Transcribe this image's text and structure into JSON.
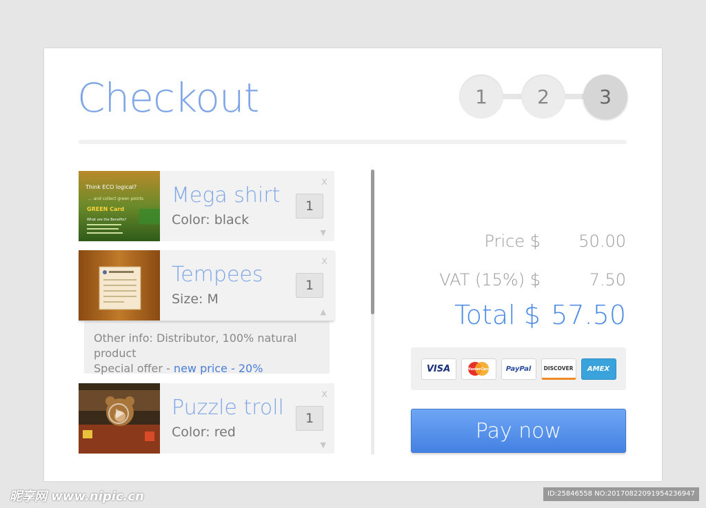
{
  "page": {
    "title": "Checkout"
  },
  "steps": [
    "1",
    "2",
    "3"
  ],
  "items": [
    {
      "name": "Mega shirt",
      "detail": "Color: black",
      "qty": "1",
      "remove": "x",
      "arrow": "▼",
      "thumb_text": [
        "Think ECO logical?",
        "... and collect green points",
        "GREEN Card",
        "What are the Benefits?"
      ]
    },
    {
      "name": "Tempees",
      "detail": "Size: M",
      "qty": "1",
      "remove": "x",
      "arrow": "▲"
    },
    {
      "name": "Puzzle troll",
      "detail": "Color: red",
      "qty": "1",
      "remove": "x",
      "arrow": "▼"
    }
  ],
  "info": {
    "line1": "Other info: Distributor, 100% natural product",
    "offer_prefix": "Special offer - ",
    "offer_link": "new price - 20%"
  },
  "summary": {
    "price_label": "Price $",
    "price_value": "50.00",
    "vat_label": "VAT (15%) $",
    "vat_value": "7.50",
    "total_label": "Total $",
    "total_value": "57.50"
  },
  "payment_cards": {
    "visa": "VISA",
    "mastercard": "MasterCard",
    "paypal": "PayPal",
    "discover": "DISCOVER",
    "amex": "AMEX"
  },
  "pay_button": "Pay now",
  "watermark": {
    "left": "昵享网 www.nipic.cn",
    "right": "ID:25846558 NO:20170822091954236947"
  },
  "colors": {
    "accent": "#7ea6e6",
    "total": "#4a8ae6",
    "pay_button": "#4f8ee8",
    "link": "#4a7dd8"
  }
}
